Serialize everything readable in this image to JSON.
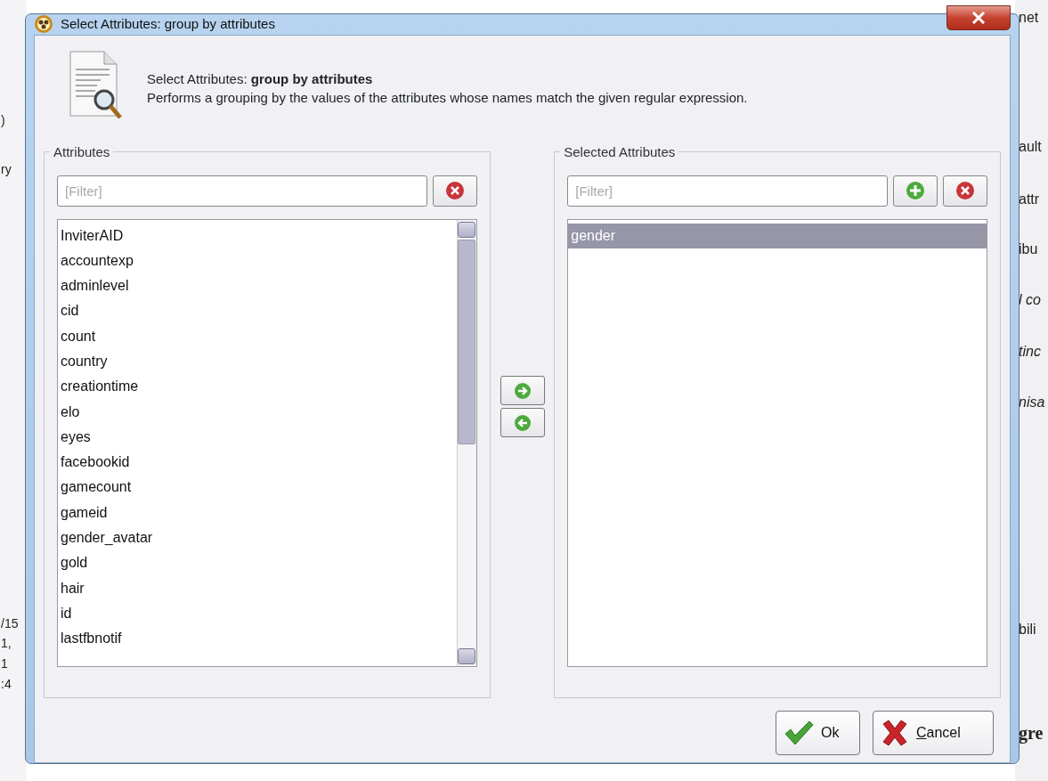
{
  "background": {
    "left_fragments": [
      {
        "text": ")",
        "kind": "plain"
      },
      {
        "text": "ry",
        "kind": "plain"
      },
      {
        "text": "/15",
        "kind": "plain"
      },
      {
        "text": "1,",
        "kind": "plain"
      },
      {
        "text": "1",
        "kind": "plain"
      },
      {
        "text": ":4",
        "kind": "plain"
      }
    ],
    "right_fragments": [
      {
        "text": "net",
        "kind": "plain"
      },
      {
        "text": "ault",
        "kind": "plain"
      },
      {
        "text": "attr",
        "kind": "plain"
      },
      {
        "text": "ibu",
        "kind": "plain"
      },
      {
        "text": "l co",
        "kind": "italic"
      },
      {
        "text": "tinc",
        "kind": "italic"
      },
      {
        "text": "nisa",
        "kind": "italic"
      },
      {
        "text": "bili",
        "kind": "plain"
      },
      {
        "text": "gre",
        "kind": "bold"
      }
    ]
  },
  "window": {
    "title": "Select Attributes: group by attributes"
  },
  "header": {
    "title": "Select Attributes: **group by attributes**",
    "description": "Performs a grouping by the values of the attributes whose names match the given regular expression."
  },
  "available": {
    "label": "Attributes",
    "filter": {
      "placeholder": "[Filter]"
    },
    "items": [
      {
        "text": "InviterAID",
        "selected": false
      },
      {
        "text": "accountexp",
        "selected": false
      },
      {
        "text": "adminlevel",
        "selected": false
      },
      {
        "text": "cid",
        "selected": false
      },
      {
        "text": "count",
        "selected": false
      },
      {
        "text": "country",
        "selected": false
      },
      {
        "text": "creationtime",
        "selected": false
      },
      {
        "text": "elo",
        "selected": false
      },
      {
        "text": "eyes",
        "selected": false
      },
      {
        "text": "facebookid",
        "selected": false
      },
      {
        "text": "gamecount",
        "selected": false
      },
      {
        "text": "gameid",
        "selected": false
      },
      {
        "text": "gender_avatar",
        "selected": false
      },
      {
        "text": "gold",
        "selected": false
      },
      {
        "text": "hair",
        "selected": false
      },
      {
        "text": "id",
        "selected": false
      },
      {
        "text": "lastfbnotif",
        "selected": false
      }
    ]
  },
  "chosen": {
    "label": "Selected Attributes",
    "filter": {
      "placeholder": "[Filter]"
    },
    "items": [
      {
        "text": "gender",
        "selected": true
      }
    ]
  },
  "buttons": [
    {
      "label": "Ok",
      "kind": "ok"
    },
    {
      "label": "Cancel",
      "kind": "cancel",
      "first_letter_underlined": true
    }
  ]
}
